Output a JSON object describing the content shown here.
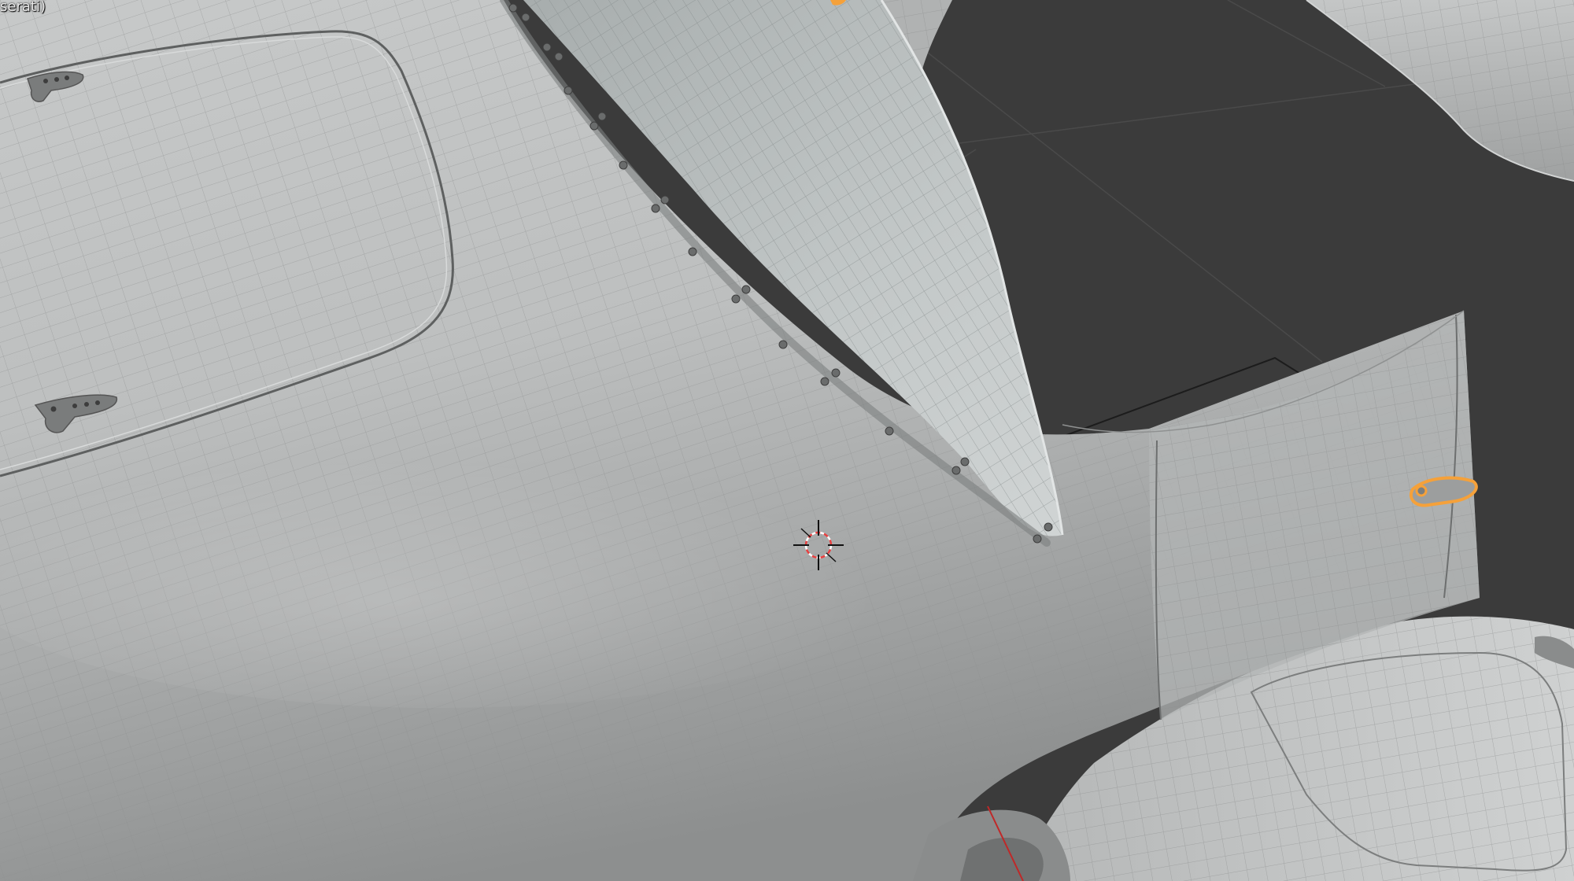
{
  "viewport": {
    "object_label": "serati)",
    "colors": {
      "background_dark": "#3b3b3b",
      "body_surface": "#b8b8b8",
      "wire": "#8f8f8f",
      "selection": "#f5a13a",
      "cursor_red": "#e84040",
      "axis_red": "#c02828"
    }
  }
}
